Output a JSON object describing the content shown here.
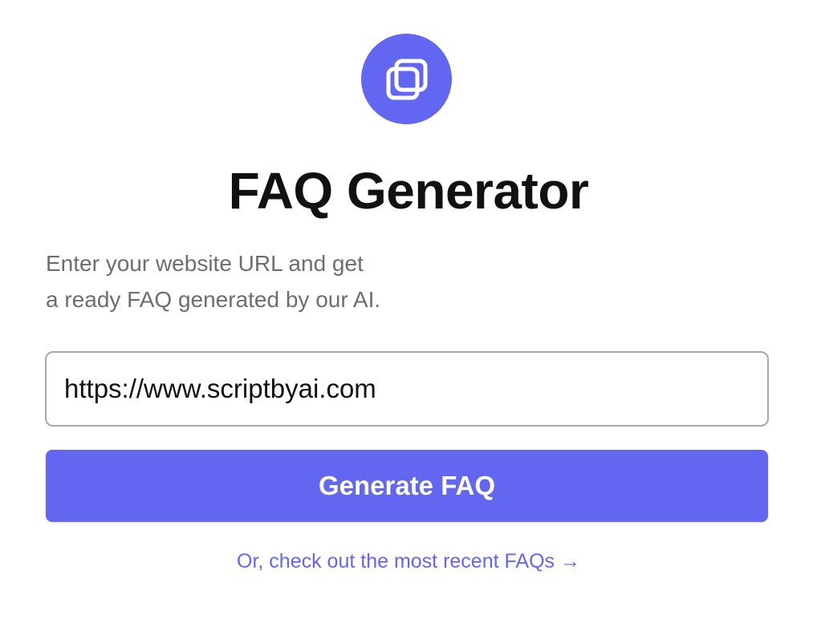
{
  "logo": {
    "icon": "stacked-squares-icon",
    "color": "#6366f1"
  },
  "title": "FAQ Generator",
  "subtitle": {
    "line1": "Enter your website URL and get",
    "line2": "a ready FAQ generated by our AI."
  },
  "url_input": {
    "value": "https://www.scriptbyai.com"
  },
  "generate_button": {
    "label": "Generate FAQ",
    "color": "#6366f1"
  },
  "recent_link": {
    "label": "Or, check out the most recent FAQs →",
    "color": "#6366f1"
  }
}
